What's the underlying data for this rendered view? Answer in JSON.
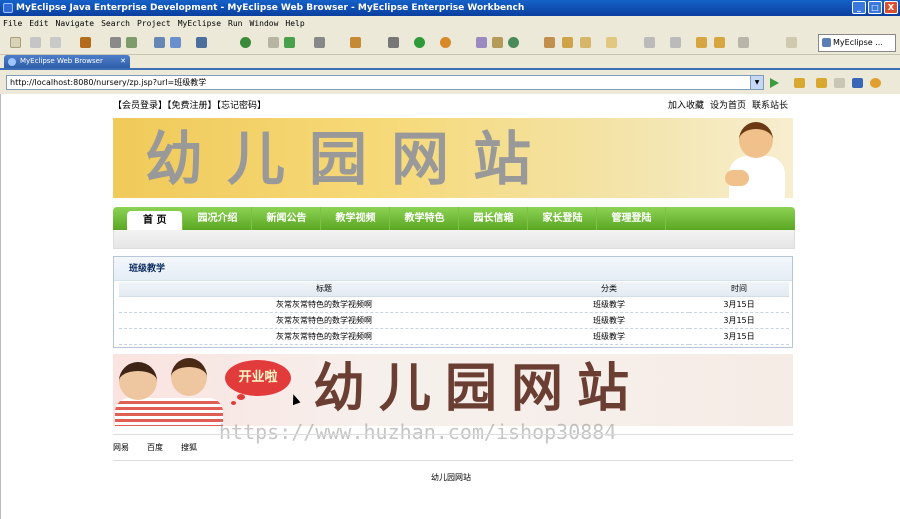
{
  "window": {
    "title": "MyEclipse Java Enterprise Development - MyEclipse Web Browser - MyEclipse Enterprise Workbench",
    "minimize": "_",
    "maximize": "□",
    "close": "X"
  },
  "menubar": {
    "items": [
      "File",
      "Edit",
      "Navigate",
      "Search",
      "Project",
      "MyEclipse",
      "Run",
      "Window",
      "Help"
    ]
  },
  "toolbar": {
    "perspective_label": "MyEclipse ..."
  },
  "editor_tab": {
    "label": "MyEclipse Web Browser",
    "close": "✕"
  },
  "address_bar": {
    "url": "http://localhost:8080/nursery/zp.jsp?url=班级教学"
  },
  "site": {
    "top_left_links": "【会员登录】【免费注册】【忘记密码】",
    "top_right_links": [
      "加入收藏",
      "设为首页",
      "联系站长"
    ],
    "banner_title": "幼儿园网站",
    "nav": [
      "首 页",
      "园况介绍",
      "新闻公告",
      "教学视频",
      "教学特色",
      "园长信箱",
      "家长登陆",
      "管理登陆"
    ],
    "section_title": "班级教学",
    "table": {
      "headers": [
        "标题",
        "分类",
        "时间"
      ],
      "rows": [
        [
          "灰常灰常特色的数学视频啊",
          "班级教学",
          "3月15日"
        ],
        [
          "灰常灰常特色的数学视频啊",
          "班级教学",
          "3月15日"
        ],
        [
          "灰常灰常特色的数学视频啊",
          "班级教学",
          "3月15日"
        ]
      ]
    },
    "banner2_badge": "开业啦",
    "banner2_title": "幼儿园网站",
    "watermark": "https://www.huzhan.com/ishop30884",
    "footer_links": [
      "网易",
      "百度",
      "搜狐"
    ],
    "footer_text": "幼儿园网站"
  }
}
